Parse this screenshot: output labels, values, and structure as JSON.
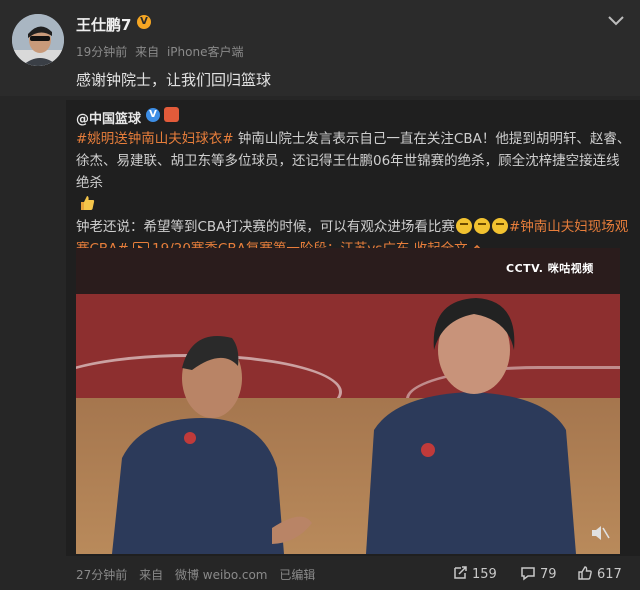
{
  "post": {
    "author": "王仕鹏7",
    "verified_badge": "V",
    "time": "19分钟前",
    "source_prefix": "来自",
    "source": "iPhone客户端",
    "text": "感谢钟院士，让我们回归篮球"
  },
  "repost": {
    "author": "@中国篮球",
    "tag1": "#姚明送钟南山夫妇球衣#",
    "body1": " 钟南山院士发言表示自己一直在关注CBA！他提到胡明轩、赵睿、徐杰、易建联、胡卫东等多位球员，还记得王仕鹏06年世锦赛的绝杀，顾全沈梓捷空接连线绝杀",
    "body2": "钟老还说：希望等到CBA打决赛的时候，可以有观众进场看比赛",
    "tag2": "#钟南山夫妇现场观赛CBA#",
    "video_link": "19/20赛季CBA复赛第一阶段：江苏vs广东",
    "collapse": "收起全文",
    "video_logo": "CCTV.  咪咕视频",
    "meta": {
      "time": "27分钟前",
      "source_prefix": "来自",
      "source": "微博 weibo.com",
      "edited": "已编辑"
    },
    "actions": {
      "repost_count": "159",
      "comment_count": "79",
      "like_count": "617"
    }
  },
  "colors": {
    "accent": "#e87e3b",
    "background": "#262626",
    "repost_bg": "#1f1f1f"
  }
}
